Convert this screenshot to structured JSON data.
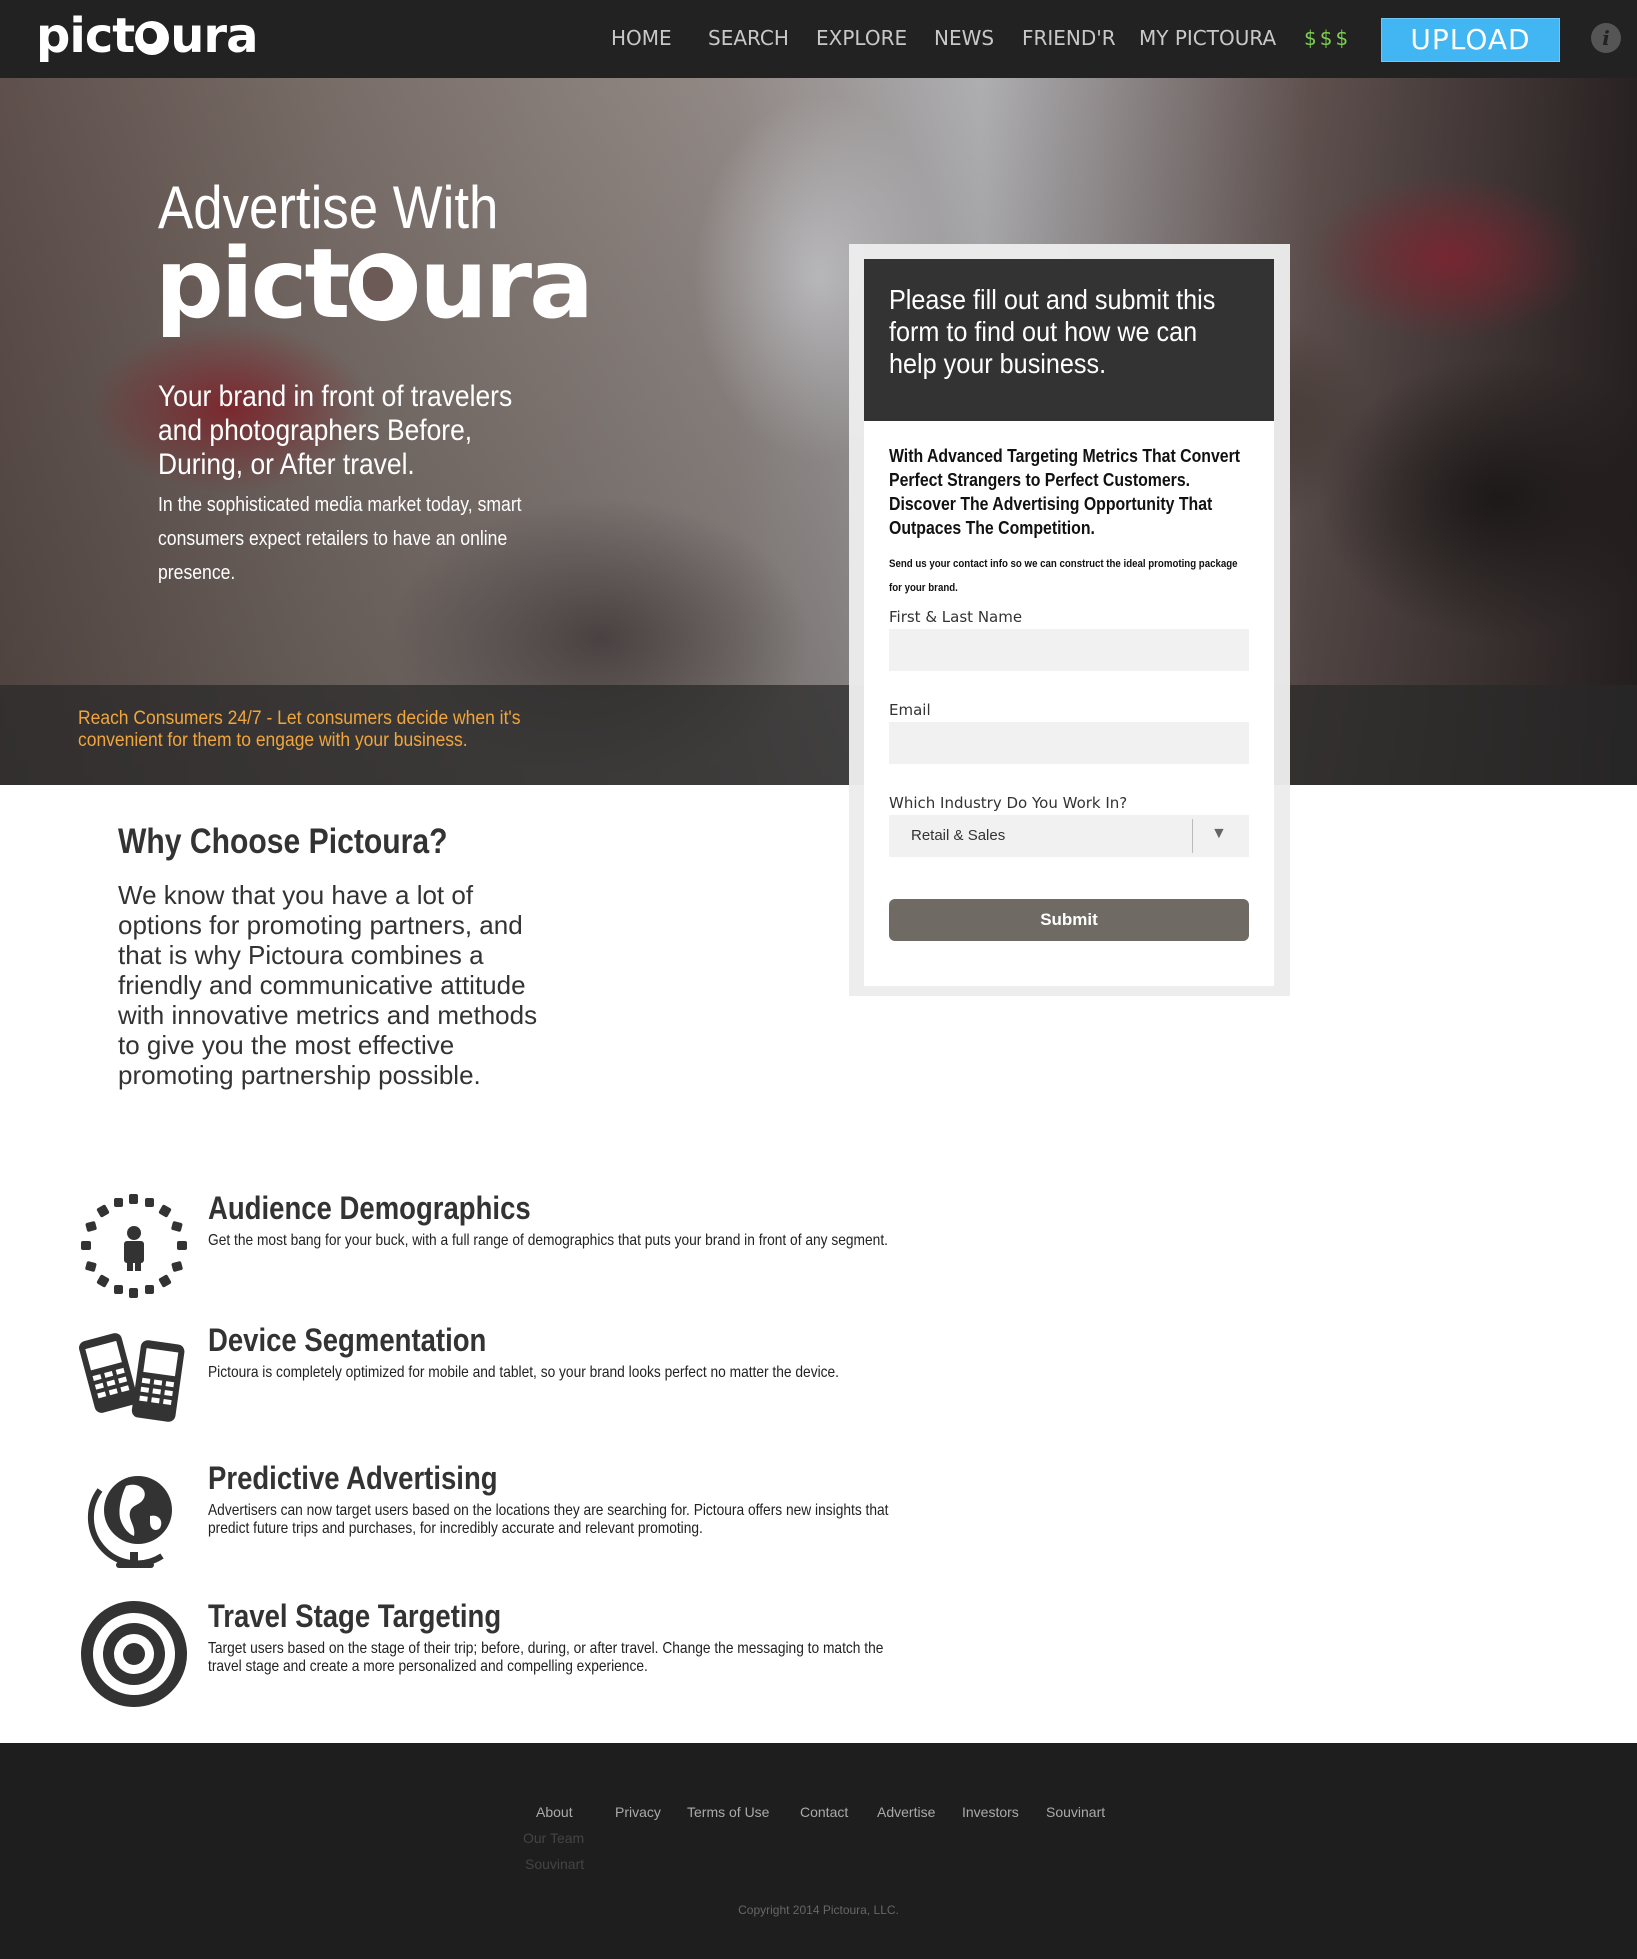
{
  "nav": {
    "logo": "pictoura",
    "links": [
      "HOME",
      "SEARCH",
      "EXPLORE",
      "NEWS",
      "FRIEND'R",
      "MY PICTOURA"
    ],
    "money": "$$$",
    "upload": "UPLOAD",
    "info": "i"
  },
  "hero": {
    "title": "Advertise With",
    "logo": "pictoura",
    "tagline": "Your brand in front of travelers and photographers Before, During, or After travel.",
    "sub": "In the sophisticated media market today, smart consumers expect retailers to have an online presence.",
    "reach": "Reach Consumers 24/7 - Let consumers decide when it's convenient for them to engage with your business."
  },
  "form": {
    "heading": "Please fill out and submit this form to find out how we can help your business.",
    "intro": "With Advanced Targeting Metrics That Convert Perfect Strangers to Perfect Customers. Discover The Advertising Opportunity That Outpaces The Competition.",
    "small": "Send us your contact info so we can construct the ideal promoting package for your brand.",
    "name_label": "First & Last Name",
    "name_value": "",
    "email_label": "Email",
    "email_value": "",
    "industry_label": "Which Industry Do You Work In?",
    "industry_value": "Retail & Sales",
    "submit": "Submit"
  },
  "why": {
    "title": "Why Choose Pictoura?",
    "text": "We know that you have a lot of options for promoting partners, and that is why Pictoura combines a friendly and communicative attitude with innovative metrics and methods to give you the most effective promoting partnership possible."
  },
  "features": [
    {
      "title": "Audience Demographics",
      "desc": "Get the most bang for your buck, with a full range of demographics that puts your brand in front of any segment.",
      "icon": "audience-icon"
    },
    {
      "title": "Device Segmentation",
      "desc": "Pictoura is completely optimized for mobile and tablet, so your brand looks perfect no matter the device.",
      "icon": "devices-icon"
    },
    {
      "title": "Predictive Advertising",
      "desc": "Advertisers can now target users based on the locations they are searching for. Pictoura offers new insights that predict future trips and purchases, for incredibly accurate and relevant promoting.",
      "icon": "globe-icon"
    },
    {
      "title": "Travel Stage Targeting",
      "desc": "Target users based on the stage of their trip; before, during, or after travel. Change the messaging to match the travel stage and create a more personalized and compelling experience.",
      "icon": "target-icon"
    }
  ],
  "footer": {
    "links": [
      "About",
      "Privacy",
      "Terms of Use",
      "Contact",
      "Advertise",
      "Investors",
      "Souvinart"
    ],
    "about_sub": [
      "Our Team",
      "Souvinart"
    ],
    "copyright": "Copyright 2014 Pictoura, LLC."
  }
}
